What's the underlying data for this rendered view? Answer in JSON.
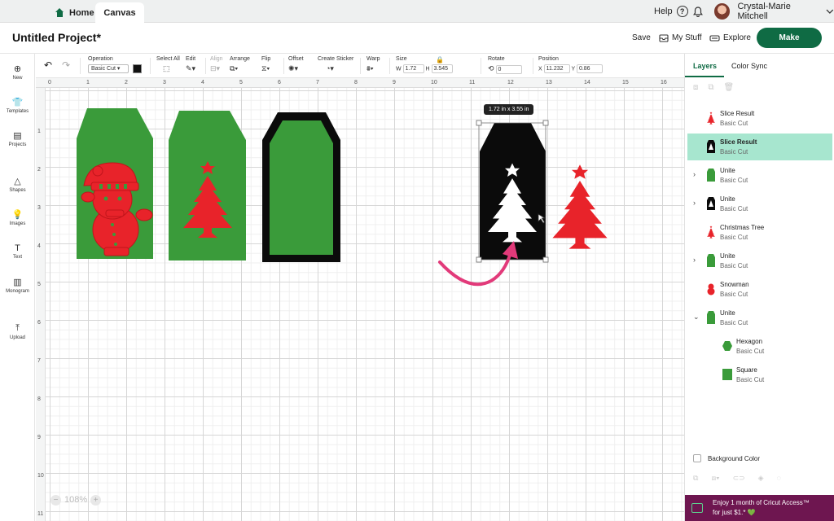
{
  "topbar": {
    "home": "Home",
    "canvas": "Canvas",
    "help": "Help",
    "help_icon": "?",
    "user": "Crystal-Marie Mitchell"
  },
  "titlebar": {
    "title": "Untitled Project*",
    "save": "Save",
    "my_stuff": "My Stuff",
    "explore": "Explore",
    "make": "Make"
  },
  "toolbar": {
    "operation_label": "Operation",
    "operation_value": "Basic Cut",
    "select_all": "Select All",
    "edit": "Edit",
    "align": "Align",
    "arrange": "Arrange",
    "flip": "Flip",
    "offset": "Offset",
    "create_sticker": "Create Sticker",
    "warp": "Warp",
    "size": "Size",
    "w_label": "W",
    "w_value": "1.72",
    "h_label": "H",
    "h_value": "3.545",
    "rotate": "Rotate",
    "rotate_value": "0",
    "position": "Position",
    "x_label": "X",
    "x_value": "11.232",
    "y_label": "Y",
    "y_value": "0.86"
  },
  "sidebar": {
    "items": [
      {
        "label": "New",
        "icon": "plus-circle-icon"
      },
      {
        "label": "Templates",
        "icon": "shirt-icon"
      },
      {
        "label": "Projects",
        "icon": "projects-icon"
      },
      {
        "label": "Shapes",
        "icon": "shapes-icon"
      },
      {
        "label": "Images",
        "icon": "bulb-icon"
      },
      {
        "label": "Text",
        "icon": "text-icon"
      },
      {
        "label": "Monogram",
        "icon": "monogram-icon"
      },
      {
        "label": "Upload",
        "icon": "upload-icon"
      }
    ]
  },
  "ruler": {
    "top": [
      "0",
      "1",
      "2",
      "3",
      "4",
      "5",
      "6",
      "7",
      "8",
      "9",
      "10",
      "11",
      "12",
      "13",
      "14",
      "15",
      "16"
    ],
    "left": [
      "1",
      "2",
      "3",
      "4",
      "5",
      "6",
      "7",
      "8",
      "9",
      "10",
      "11"
    ]
  },
  "canvas": {
    "size_tooltip": "1.72  in x 3.55  in",
    "zoom": "108%",
    "colors": {
      "green": "#3a9b3a",
      "red": "#e8232a",
      "black": "#0b0b0b",
      "pink": "#e23a7a"
    }
  },
  "layers_panel": {
    "tab_layers": "Layers",
    "tab_color_sync": "Color Sync",
    "layers": [
      {
        "name": "Slice Result",
        "sub": "Basic Cut",
        "thumb": "tree-red",
        "selected": false,
        "expander": ""
      },
      {
        "name": "Slice Result",
        "sub": "Basic Cut",
        "thumb": "tag-black",
        "selected": true,
        "expander": ""
      },
      {
        "name": "Unite",
        "sub": "Basic Cut",
        "thumb": "tag-green",
        "selected": false,
        "expander": "›"
      },
      {
        "name": "Unite",
        "sub": "Basic Cut",
        "thumb": "tag-black",
        "selected": false,
        "expander": "›"
      },
      {
        "name": "Christmas Tree",
        "sub": "Basic Cut",
        "thumb": "tree-red",
        "selected": false,
        "expander": ""
      },
      {
        "name": "Unite",
        "sub": "Basic Cut",
        "thumb": "tag-green",
        "selected": false,
        "expander": "›"
      },
      {
        "name": "Snowman",
        "sub": "Basic Cut",
        "thumb": "snowman-red",
        "selected": false,
        "expander": ""
      },
      {
        "name": "Unite",
        "sub": "Basic Cut",
        "thumb": "tag-green",
        "selected": false,
        "expander": "⌄"
      },
      {
        "name": "Hexagon",
        "sub": "Basic Cut",
        "thumb": "hexagon-green",
        "selected": false,
        "expander": "",
        "child": true
      },
      {
        "name": "Square",
        "sub": "Basic Cut",
        "thumb": "square-green",
        "selected": false,
        "expander": "",
        "child": true
      }
    ],
    "background_color": "Background Color",
    "promo_line1": "Enjoy 1 month of Cricut Access™",
    "promo_line2": "for just $1.* 💚"
  }
}
